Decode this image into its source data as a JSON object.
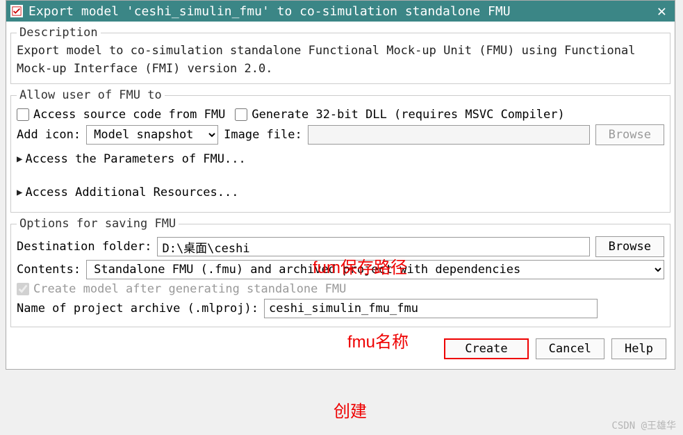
{
  "titlebar": {
    "title": "Export model 'ceshi_simulin_fmu' to co-simulation standalone FMU"
  },
  "description": {
    "legend": "Description",
    "text": "Export model to co-simulation standalone Functional Mock-up Unit (FMU) using Functional Mock-up Interface (FMI) version 2.0."
  },
  "allow": {
    "legend": "Allow user of FMU to",
    "access_source_label": "Access source code from FMU",
    "gen32_label": "Generate 32-bit DLL (requires MSVC Compiler)",
    "add_icon_label": "Add icon:",
    "add_icon_value": "Model snapshot",
    "image_file_label": "Image file:",
    "image_file_value": "",
    "browse_label": "Browse",
    "expander_params": "Access the Parameters of FMU...",
    "expander_resources": "Access Additional Resources..."
  },
  "options": {
    "legend": "Options for saving FMU",
    "dest_label": "Destination folder:",
    "dest_value": "D:\\桌面\\ceshi",
    "browse_label": "Browse",
    "contents_label": "Contents:",
    "contents_value": "Standalone FMU (.fmu) and archived project with dependencies",
    "create_model_label": "Create model after generating standalone FMU",
    "archive_label": "Name of project archive (.mlproj):",
    "archive_value": "ceshi_simulin_fmu_fmu"
  },
  "buttons": {
    "create": "Create",
    "cancel": "Cancel",
    "help": "Help"
  },
  "annotations": {
    "path": "fum保存路径",
    "name": "fmu名称",
    "create": "创建"
  },
  "watermark": "CSDN @王雄华"
}
